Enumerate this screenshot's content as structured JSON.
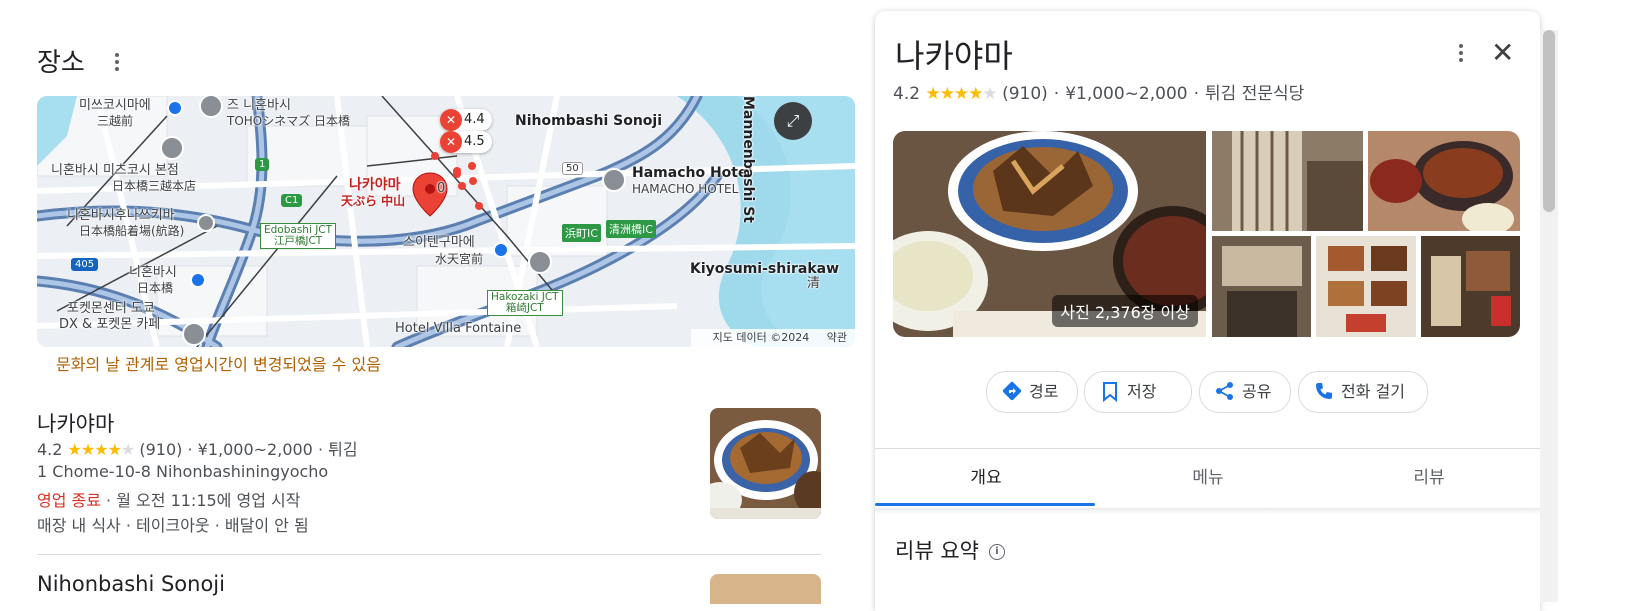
{
  "section": {
    "title": "장소"
  },
  "map": {
    "labels": {
      "mitsukoshi_station": "미쓰코시마에",
      "mitsukoshi_station_jp": "三越前",
      "toho": "즈 니혼바시",
      "toho_jp": "TOHOシネマズ 日本橋",
      "mitsukoshi_store": "니혼바시 미츠코시 본점",
      "mitsukoshi_store_jp": "日本橋三越本店",
      "ship_pier": "니혼바시후나쓰키바",
      "ship_pier_jp": "日本橋船着場(航路)",
      "nihonbashi_station": "니혼바시",
      "nihonbashi_station_jp": "日本橋",
      "pokemon": "포켓몬센터 도쿄",
      "pokemon2": "DX & 포켓몬 카페",
      "nakayama": "나카야마",
      "nakayama_jp": "天ぷら 中山",
      "sonoji": "Nihombashi Sonoji",
      "hamacho_hotel": "Hamacho Hotel",
      "hamacho_hotel_jp": "HAMACHO HOTEL",
      "suitengumae": "스이텐구마에",
      "suitengumae_jp": "水天宮前",
      "mannenbashi": "Mannenbashi St",
      "kiyosumi": "Kiyosumi-shirakaw",
      "kiyosumi_jp": "清",
      "hotel_villa": "Hotel Villa Fontaine",
      "edobashi_jct": "Edobashi JCT",
      "edobashi_jct_jp": "江戸橋JCT",
      "hakozaki_jct": "Hakozaki JCT",
      "hakozaki_jct_jp": "箱崎JCT",
      "hamacho_ic": "浜町IC",
      "kiyosu_ic": "清洲橋IC",
      "route_1": "1",
      "route_c1": "C1",
      "route_405": "405",
      "route_50": "50",
      "pin_a_rating": "4.4",
      "pin_b_rating": "4.5",
      "pin_c_rating": "0"
    },
    "footer": {
      "data": "지도 데이터 ©2024",
      "terms": "약관"
    }
  },
  "notice": "문화의 날 관계로 영업시간이 변경되었을 수 있음",
  "result": {
    "name": "나카야마",
    "rating": "4.2",
    "reviews": "(910)",
    "price": "¥1,000~2,000",
    "category": "튀김",
    "address": "1 Chome-10-8 Nihonbashiningyocho",
    "status": "영업 종료",
    "hours": "월 오전 11:15에 영업 시작",
    "services": "매장 내 식사 · 테이크아웃 · 배달이 안 됨",
    "sep": " · "
  },
  "next_result": {
    "name": "Nihonbashi Sonoji"
  },
  "panel": {
    "title": "나카야마",
    "rating": "4.2",
    "reviews": "(910)",
    "price": "¥1,000~2,000",
    "category": "튀김 전문식당",
    "photo_count": "사진 2,376장 이상",
    "actions": {
      "directions": "경로",
      "save": "저장",
      "share": "공유",
      "call": "전화 걸기"
    },
    "tabs": {
      "overview": "개요",
      "menu": "메뉴",
      "reviews": "리뷰"
    },
    "review_summary": "리뷰 요약"
  },
  "colors": {
    "accent": "#1a73e8",
    "star": "#fbbc04",
    "closed": "#d93025",
    "notice": "#b06000",
    "pin": "#ea4335"
  }
}
